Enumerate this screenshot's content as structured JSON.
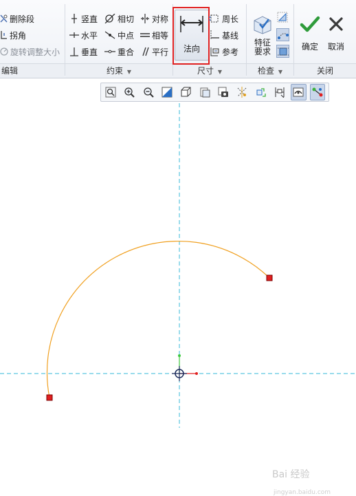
{
  "ribbon": {
    "edit": {
      "label": "编辑",
      "items": [
        {
          "label": "删除段",
          "icon": "delete-segment-icon"
        },
        {
          "label": "拐角",
          "icon": "corner-icon"
        },
        {
          "label": "旋转调整大小",
          "icon": "rotate-resize-icon",
          "disabled": true
        }
      ]
    },
    "constraints": {
      "label": "约束",
      "items": [
        {
          "label": "竖直",
          "icon": "vertical-constraint-icon"
        },
        {
          "label": "相切",
          "icon": "tangent-constraint-icon"
        },
        {
          "label": "对称",
          "icon": "symmetric-constraint-icon"
        },
        {
          "label": "水平",
          "icon": "horizontal-constraint-icon"
        },
        {
          "label": "中点",
          "icon": "midpoint-constraint-icon"
        },
        {
          "label": "相等",
          "icon": "equal-constraint-icon"
        },
        {
          "label": "垂直",
          "icon": "perpendicular-constraint-icon"
        },
        {
          "label": "重合",
          "icon": "coincident-constraint-icon"
        },
        {
          "label": "平行",
          "icon": "parallel-constraint-icon"
        }
      ]
    },
    "dimension": {
      "label": "尺寸",
      "normal_label": "法向",
      "items": [
        {
          "label": "周长",
          "icon": "perimeter-icon"
        },
        {
          "label": "基线",
          "icon": "baseline-icon"
        },
        {
          "label": "参考",
          "icon": "reference-icon"
        }
      ]
    },
    "inspect": {
      "label": "检查",
      "feature_req_label": "特征\n要求"
    },
    "close": {
      "label": "关闭",
      "ok_label": "确定",
      "cancel_label": "取消"
    }
  },
  "view_toolbar": [
    {
      "icon": "refit-icon"
    },
    {
      "icon": "zoom-in-icon"
    },
    {
      "icon": "zoom-out-icon"
    },
    {
      "icon": "repaint-icon"
    },
    {
      "icon": "display-style-icon"
    },
    {
      "icon": "saved-orientations-icon"
    },
    {
      "icon": "view-manager-icon"
    },
    {
      "icon": "datum-display-icon"
    },
    {
      "icon": "spin-center-icon"
    },
    {
      "icon": "annotation-display-icon"
    },
    {
      "icon": "sketch-view-icon",
      "active": true
    },
    {
      "icon": "sketcher-display-icon",
      "active": true
    }
  ],
  "colors": {
    "arc": "#f0a020",
    "endpoint": "#e02020",
    "centerline": "#35b8d8",
    "highlight": "#e02020"
  },
  "watermark": {
    "text": "Bai 经验",
    "url": "jingyan.baidu.com"
  }
}
